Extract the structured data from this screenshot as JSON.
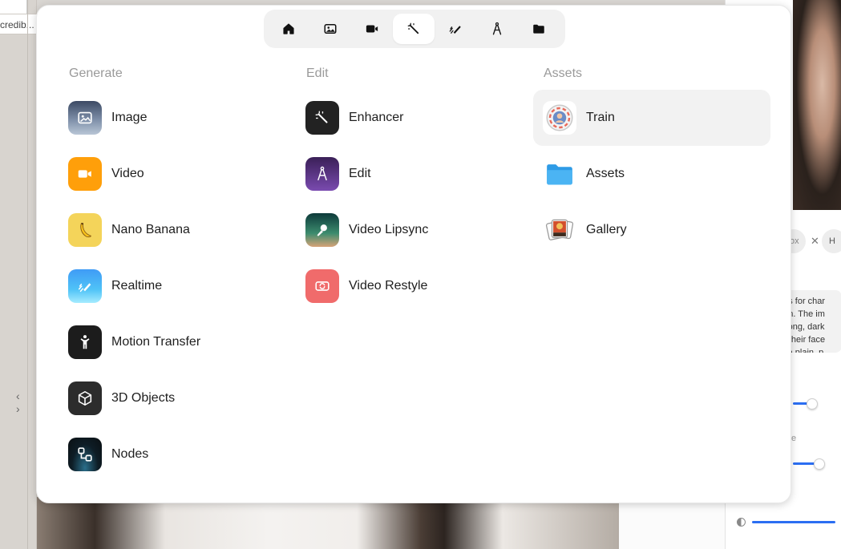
{
  "background": {
    "url_fragment": "credib...",
    "nav_arrows": "‹ ›",
    "chip_left": "ox",
    "chip_right": "H",
    "prompt_snippet": [
      "ges for char",
      "rain. The im",
      "h long, dark",
      "ar their face",
      "st a plain, p"
    ],
    "slider_label": "e"
  },
  "modal": {
    "topnav": {
      "tabs": [
        "home-icon",
        "image-icon",
        "video-camera-icon",
        "magic-wand-icon",
        "pen-sparkle-icon",
        "compass-icon",
        "folder-icon"
      ],
      "active_index": 3
    },
    "columns": {
      "generate": {
        "title": "Generate",
        "items": [
          {
            "label": "Image",
            "icon": "image-icon"
          },
          {
            "label": "Video",
            "icon": "video-camera-icon"
          },
          {
            "label": "Nano Banana",
            "icon": "banana-icon"
          },
          {
            "label": "Realtime",
            "icon": "pen-sparkle-icon"
          },
          {
            "label": "Motion Transfer",
            "icon": "person-icon"
          },
          {
            "label": "3D Objects",
            "icon": "cube-icon"
          },
          {
            "label": "Nodes",
            "icon": "nodes-icon"
          }
        ]
      },
      "edit": {
        "title": "Edit",
        "items": [
          {
            "label": "Enhancer",
            "icon": "magic-wand-icon"
          },
          {
            "label": "Edit",
            "icon": "compass-icon"
          },
          {
            "label": "Video Lipsync",
            "icon": "microphone-icon"
          },
          {
            "label": "Video Restyle",
            "icon": "restyle-icon"
          }
        ]
      },
      "assets": {
        "title": "Assets",
        "items": [
          {
            "label": "Train",
            "icon": "train-icon",
            "highlighted": true
          },
          {
            "label": "Assets",
            "icon": "folder-icon"
          },
          {
            "label": "Gallery",
            "icon": "gallery-icon"
          }
        ]
      }
    }
  },
  "colors": {
    "accent_blue": "#2b6ef2",
    "video_orange": "#ff9f0a",
    "restyle_red": "#f06b6b"
  }
}
